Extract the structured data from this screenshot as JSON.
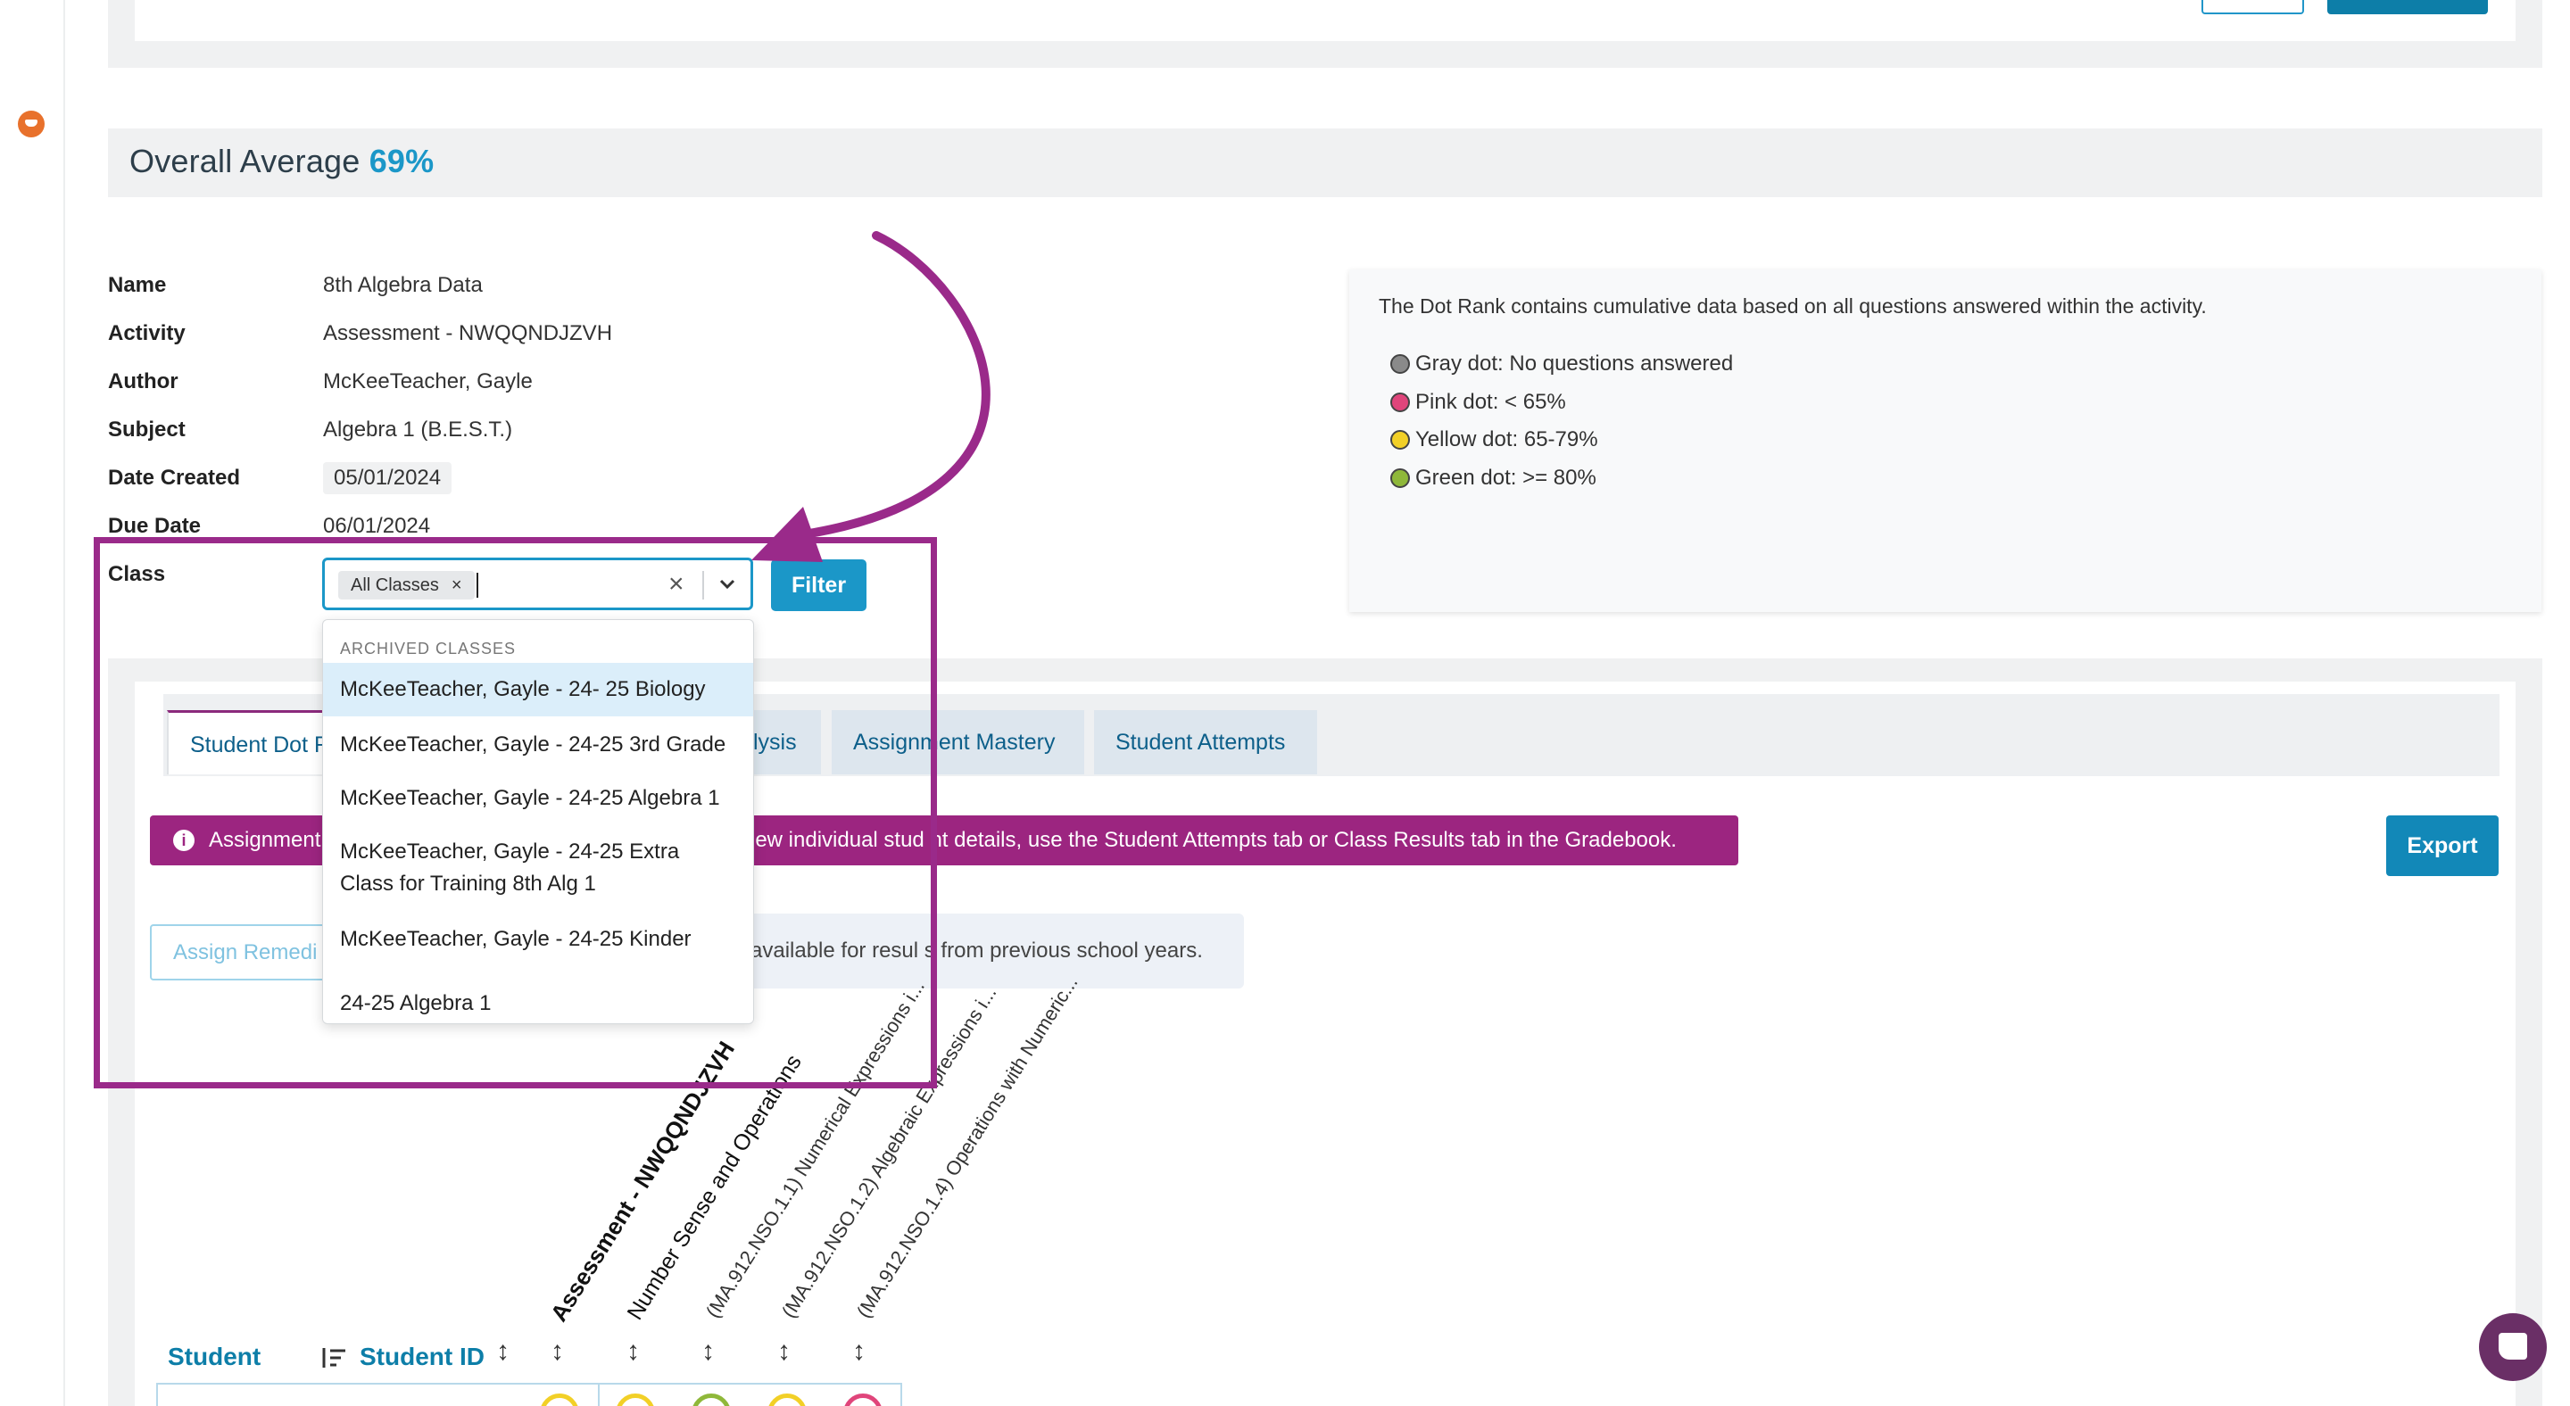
{
  "overall": {
    "label": "Overall Average",
    "value": "69%"
  },
  "info": {
    "rows": [
      {
        "label": "Name",
        "value": "8th Algebra Data"
      },
      {
        "label": "Activity",
        "value": "Assessment - NWQQNDJZVH"
      },
      {
        "label": "Author",
        "value": "McKeeTeacher, Gayle"
      },
      {
        "label": "Subject",
        "value": "Algebra 1 (B.E.S.T.)"
      },
      {
        "label": "Date Created",
        "value": "05/01/2024"
      },
      {
        "label": "Due Date",
        "value": "06/01/2024"
      }
    ],
    "class_label": "Class"
  },
  "class_select": {
    "chip": "All Classes",
    "chip_remove": "×",
    "clear": "×"
  },
  "filter_label": "Filter",
  "legend": {
    "intro": "The Dot Rank contains cumulative data based on all questions answered within the activity.",
    "items": [
      {
        "text": "Gray dot: No questions answered",
        "color": "#8a8a8a"
      },
      {
        "text": "Pink dot: < 65%",
        "color": "#e0457b"
      },
      {
        "text": "Yellow dot: 65-79%",
        "color": "#f2d027"
      },
      {
        "text": "Green dot: >= 80%",
        "color": "#8fb83a"
      }
    ]
  },
  "tabs": [
    {
      "label": "Student Dot R"
    },
    {
      "label": "lysis"
    },
    {
      "label": "Assignment Mastery"
    },
    {
      "label": "Student Attempts"
    }
  ],
  "alert": {
    "icon": "i",
    "text_left": "Assignment",
    "text_right": "iew individual stud  nt details, use the Student Attempts tab or Class Results tab in the Gradebook."
  },
  "export_label": "Export",
  "remediation_label": "Assign Remedi",
  "info_box_text": "available for resul  s from previous school years.",
  "column_headers": [
    "Assessment - NWQQNDJZVH",
    "Number Sense and Operations",
    "(MA.912.NSO.1.1) Numerical Expressions i...",
    "(MA.912.NSO.1.2) Algebraic Expressions i...",
    "(MA.912.NSO.1.4) Operations with Numeric..."
  ],
  "table": {
    "student_header": "Student",
    "student_id_header": "Student ID"
  },
  "dropdown": {
    "group_label": "ARCHIVED CLASSES",
    "options": [
      "McKeeTeacher, Gayle - 24- 25 Biology",
      "McKeeTeacher, Gayle - 24-25 3rd Grade",
      "McKeeTeacher, Gayle - 24-25 Algebra 1",
      "McKeeTeacher, Gayle - 24-25 Extra Class for Training 8th Alg 1",
      "McKeeTeacher, Gayle - 24-25 Kinder",
      "24-25 Algebra 1"
    ]
  },
  "ring_colors": [
    "#f2d027",
    "#f2d027",
    "#8fb83a",
    "#f2d027",
    "#e0457b"
  ],
  "annotation_color": "#9a2a8a"
}
